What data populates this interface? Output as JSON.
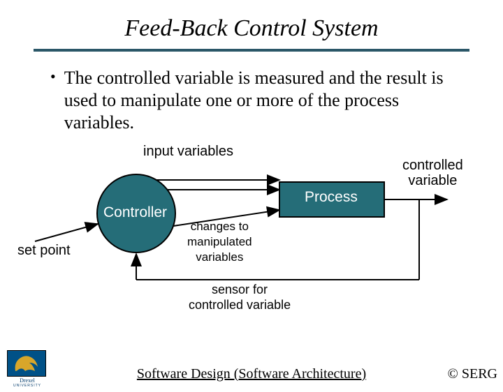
{
  "title": "Feed-Back Control System",
  "bullet": "The controlled variable is measured and the result is used to manipulate one or more of the process variables.",
  "diagram": {
    "input_variables": "input variables",
    "controller": "Controller",
    "set_point": "set point",
    "changes": "changes to\nmanipulated\nvariables",
    "process": "Process",
    "controlled_variable": "controlled\nvariable",
    "sensor": "sensor for\ncontrolled variable"
  },
  "footer": {
    "course": "Software Design (Software Architecture)",
    "copyright": "© SERG"
  },
  "logo": {
    "name": "Drexel",
    "sub": "UNIVERSITY"
  },
  "colors": {
    "teal": "#256d78",
    "underline": "#2b5768"
  }
}
